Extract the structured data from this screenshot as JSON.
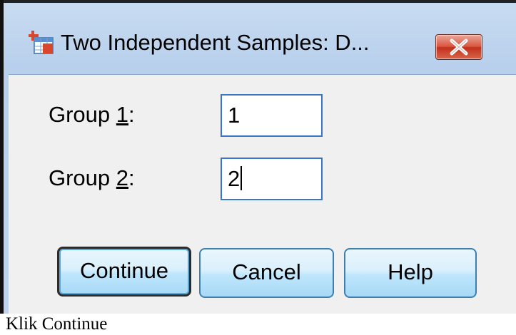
{
  "window": {
    "title": "Two Independent Samples: D...",
    "app_icon": "spss-table-icon",
    "close_icon": "close-x-icon"
  },
  "form": {
    "group1": {
      "label_pre": "Group ",
      "label_key": "1",
      "label_post": ":",
      "value": "1"
    },
    "group2": {
      "label_pre": "Group ",
      "label_key": "2",
      "label_post": ":",
      "value": "2"
    }
  },
  "buttons": {
    "continue": "Continue",
    "cancel": "Cancel",
    "help": "Help"
  },
  "caption": "Klik  Continue",
  "colors": {
    "titlebar": "#c9dcf1",
    "close_button": "#c1301c",
    "field_border": "#3a76c5",
    "button_face": "#bee6fd"
  }
}
